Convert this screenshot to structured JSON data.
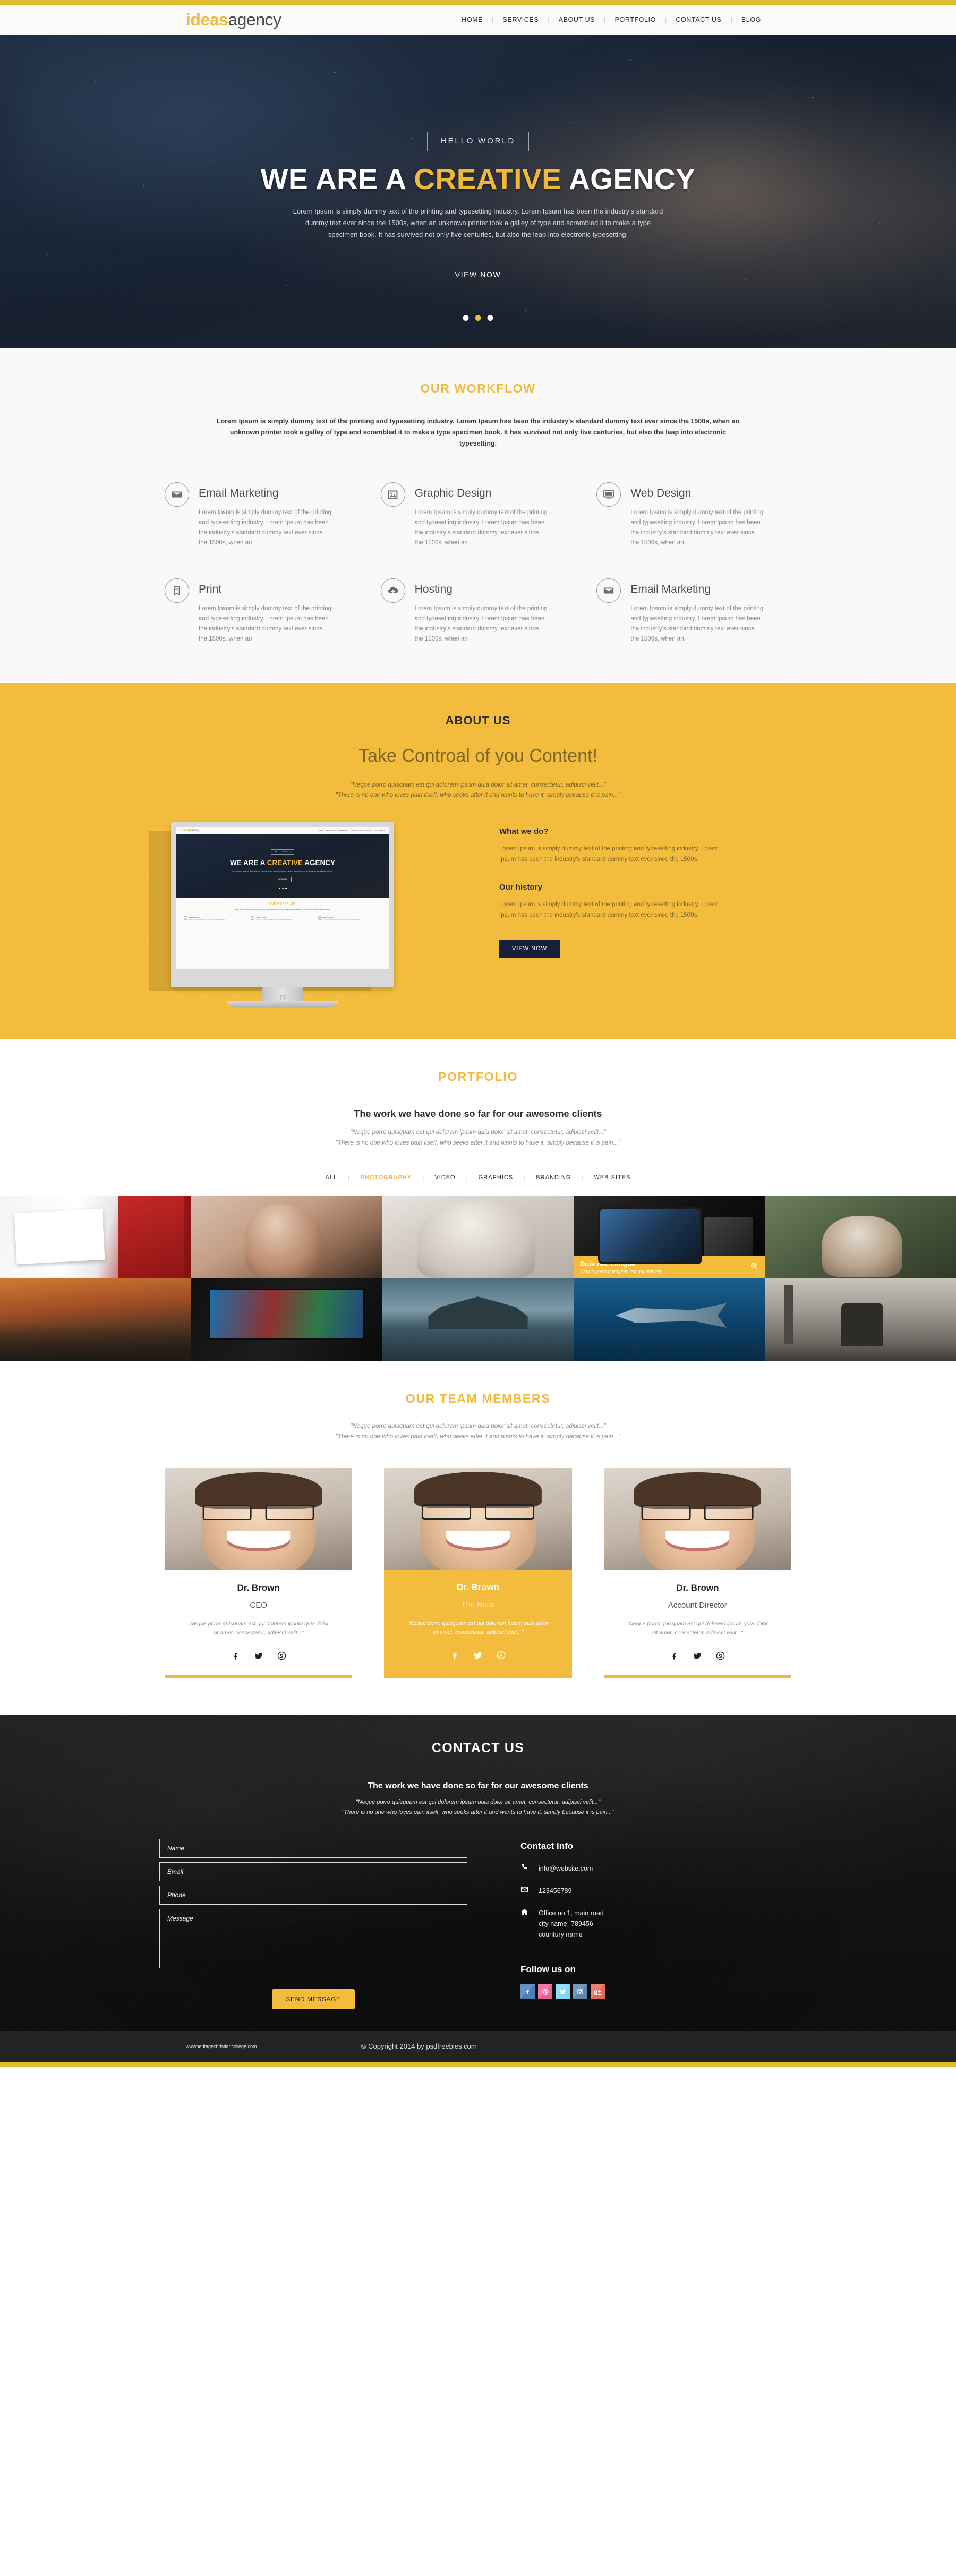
{
  "brand": {
    "part1": "ideas",
    "part2": "agency"
  },
  "colors": {
    "accent": "#f0b93c",
    "accent_bar": "#e0bb2e",
    "dark": "#16203a",
    "panel_dark": "#232323"
  },
  "nav": {
    "items": [
      "HOME",
      "SERVICES",
      "ABOUT US",
      "PORTFOLIO",
      "CONTACT US",
      "BLOG"
    ],
    "separator": "|"
  },
  "hero": {
    "badge": "HELLO  WORLD",
    "title_pre": "WE ARE A ",
    "title_hl": "CREATIVE",
    "title_post": " AGENCY",
    "paragraph": "Lorem Ipsum is simply dummy text of the printing and typesetting industry. Lorem Ipsum has been the industry's standard dummy text ever since the 1500s, when an unknown printer took a galley of type and scrambled it to make a type specimen book. It has survived not only five centuries, but also the leap into electronic typesetting.",
    "button": "VIEW NOW",
    "slider_dots": 3,
    "active_dot": 2
  },
  "workflow": {
    "title": "OUR WORKFLOW",
    "intro": "Lorem Ipsum is simply dummy text of the printing and typesetting industry. Lorem Ipsum has been the industry's standard dummy text ever since the 1500s, when an unknown printer took a galley of type and scrambled it to make a type specimen book. It has survived not only five centuries, but also the leap into electronic typesetting.",
    "body_text": "Lorem Ipsum is simply dummy text of the printing and typesetting industry. Lorem Ipsum has been the industry's standard dummy text ever since the 1500s, when an",
    "items": [
      {
        "icon": "envelope-icon",
        "glyph": "✉",
        "title": "Email Marketing"
      },
      {
        "icon": "image-icon",
        "glyph": "Ὓc",
        "title": "Graphic Design"
      },
      {
        "icon": "monitor-icon",
        "glyph": "Ὓ5",
        "title": "Web Design"
      },
      {
        "icon": "book-icon",
        "glyph": "Ὅ6",
        "title": "Print"
      },
      {
        "icon": "cloud-upload-icon",
        "glyph": "☁",
        "title": "Hosting"
      },
      {
        "icon": "envelope-open-icon",
        "glyph": "✉",
        "title": "Email Marketing"
      }
    ]
  },
  "about": {
    "title": "ABOUT US",
    "tagline": "Take Controal of you Content!",
    "quote_line1": "\"Neque porro quisquam est qui dolorem ipsum quia dolor sit amet, consectetur, adipisci velit...\"",
    "quote_line2": "\"There is no one who loves pain itself, who seeks after it and wants to have it, simply because it is pain...\"",
    "blocks": [
      {
        "heading": "What we do?",
        "text": "Lorem Ipsum is simply dummy text of the printing and typesetting industry. Lorem Ipsum has been the industry's standard dummy text ever since the 1500s,"
      },
      {
        "heading": "Our history",
        "text": "Lorem Ipsum is simply dummy text of the printing and typesetting industry. Lorem Ipsum has been the industry's standard dummy text ever since the 1500s,"
      }
    ],
    "button": "VIEW NOW",
    "mockup": {
      "brand1": "ideas",
      "brand2": "agency",
      "nav": [
        "HOME",
        "SERVICES",
        "ABOUT US",
        "PORTFOLIO",
        "CONTACT US",
        "BLOG"
      ],
      "badge": "HELLO WORLD",
      "title_pre": "WE ARE A ",
      "title_hl": "CREATIVE",
      "title_post": " AGENCY",
      "sub": "Lorem Ipsum is simply dummy text of the printing and typesetting industry. Lorem Ipsum has been the industry's standard dummy text.",
      "button": "VIEW NOW",
      "section_title": "OUR WORKFLOW",
      "section_text": "Lorem Ipsum is simply dummy text of the printing and typesetting industry. Lorem Ipsum has been the industry's standard dummy text ever since the 1500s.",
      "cards": [
        {
          "title": "Email Marketing",
          "text": "Lorem Ipsum is simply dummy text of the printing and typesetting industry."
        },
        {
          "title": "Graphic Design",
          "text": "Lorem Ipsum is simply dummy text of the printing and typesetting industry."
        },
        {
          "title": "Email Marketing",
          "text": "Lorem Ipsum is simply dummy text of the printing and typesetting industry."
        }
      ],
      "apple_logo": ""
    }
  },
  "portfolio": {
    "title": "PORTFOLIO",
    "subtitle": "The work we have done so far for our awesome clients",
    "quote_line1": "\"Neque porro quisquam est qui dolorem ipsum quia dolor sit amet, consectetur, adipisci velit...\"",
    "quote_line2": "\"There is no one who loves pain itself, who seeks after it and wants to have it, simply because it is pain...\"",
    "filters": [
      "ALL",
      "PHOTOGRAPHY",
      "VIDEO",
      "GRAPHICS",
      "BRANDING",
      "WEB SITES"
    ],
    "active_filter": "PHOTOGRAPHY",
    "separator": "|",
    "overlay": {
      "title": "Duis nec congue",
      "subtitle": "Neque porro quisquam est qui dolorem",
      "icon": "zoom-in-icon",
      "cell_index": 3
    },
    "cells": 10
  },
  "team": {
    "title": "OUR TEAM MEMBERS",
    "quote_line1": "\"Neque porro quisquam est qui dolorem ipsum quia dolor sit amet, consectetur, adipisci velit...\"",
    "quote_line2": "\"There is no one who loves pain itself, who seeks after it and wants to have it, simply because it is pain...\"",
    "member_quote": "\"Neque porro quisquam est qui dolorem ipsum quia dolor sit amet, consectetur, adipisci velit...\"",
    "members": [
      {
        "name": "Dr. Brown",
        "role": "CEO",
        "highlight": false
      },
      {
        "name": "Dr. Brown",
        "role": "The Boss",
        "highlight": true
      },
      {
        "name": "Dr. Brown",
        "role": "Account Director",
        "highlight": false
      }
    ],
    "social": [
      {
        "icon": "facebook-icon",
        "glyph": "f"
      },
      {
        "icon": "twitter-icon",
        "glyph": "🐦"
      },
      {
        "icon": "skype-icon",
        "glyph": "Ⓢ"
      }
    ]
  },
  "contact": {
    "title": "CONTACT US",
    "subtitle": "The work we have done so far for our awesome clients",
    "quote_line1": "\"Neque porro quisquam est qui dolorem ipsum quia dolor sit amet, consectetur, adipisci velit...\"",
    "quote_line2": "\"There is no one who loves pain itself, who seeks after it and wants to have it, simply because it is pain...\"",
    "form": {
      "name_placeholder": "Name",
      "email_placeholder": "Email",
      "phone_placeholder": "Phone",
      "message_placeholder": "Message",
      "submit": "SEND MESSAGE"
    },
    "info_heading": "Contact info",
    "info": [
      {
        "icon": "phone-icon",
        "glyph": "☎",
        "text": "info@website.com"
      },
      {
        "icon": "envelope-icon",
        "glyph": "✉",
        "text": "123456789"
      },
      {
        "icon": "home-icon",
        "glyph": "⌂",
        "text": "Office no 1, main road\ncity name- 789456\ncountury name"
      }
    ],
    "follow_heading": "Follow us on",
    "socials": [
      {
        "icon": "facebook-icon",
        "glyph": "f",
        "color": "#4a7cb8"
      },
      {
        "icon": "dribbble-icon",
        "glyph": "●",
        "color": "#ec5f95"
      },
      {
        "icon": "twitter-icon",
        "glyph": "🐦",
        "color": "#7fd8f5"
      },
      {
        "icon": "instagram-icon",
        "glyph": "▣",
        "color": "#5b87ac"
      },
      {
        "icon": "googleplus-icon",
        "glyph": "g+",
        "color": "#e06a56"
      }
    ]
  },
  "footer": {
    "url": "wwwheritagechristiancollege.com",
    "copyright": "© Copyright 2014  by psdfreebies.com"
  }
}
